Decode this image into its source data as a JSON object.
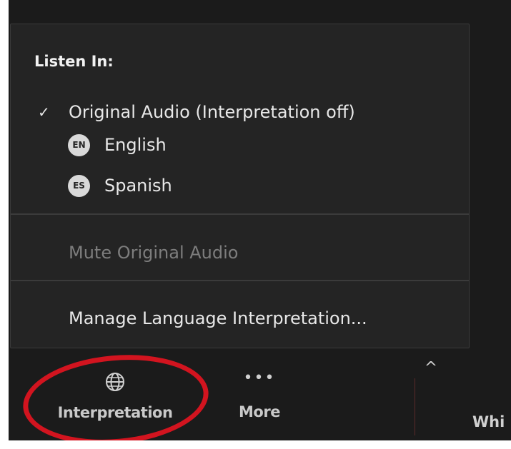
{
  "menu": {
    "heading": "Listen In:",
    "items": [
      {
        "check": "✓",
        "label": "Original Audio (Interpretation off)"
      },
      {
        "badge": "EN",
        "label": "English"
      },
      {
        "badge": "ES",
        "label": "Spanish"
      }
    ],
    "mute_label": "Mute Original Audio",
    "manage_label": "Manage Language Interpretation..."
  },
  "toolbar": {
    "interpretation": {
      "label": "Interpretation",
      "icon": "globe-icon"
    },
    "more": {
      "label": "More",
      "icon": "more-dots-icon",
      "glyph": "•••"
    },
    "caret": {
      "glyph": "^"
    },
    "partial_label": "Whi"
  },
  "colors": {
    "background": "#1b1b1b",
    "menu_background": "#242424",
    "highlight_circle": "#d2141f",
    "disabled_text": "#7d7d7d"
  }
}
